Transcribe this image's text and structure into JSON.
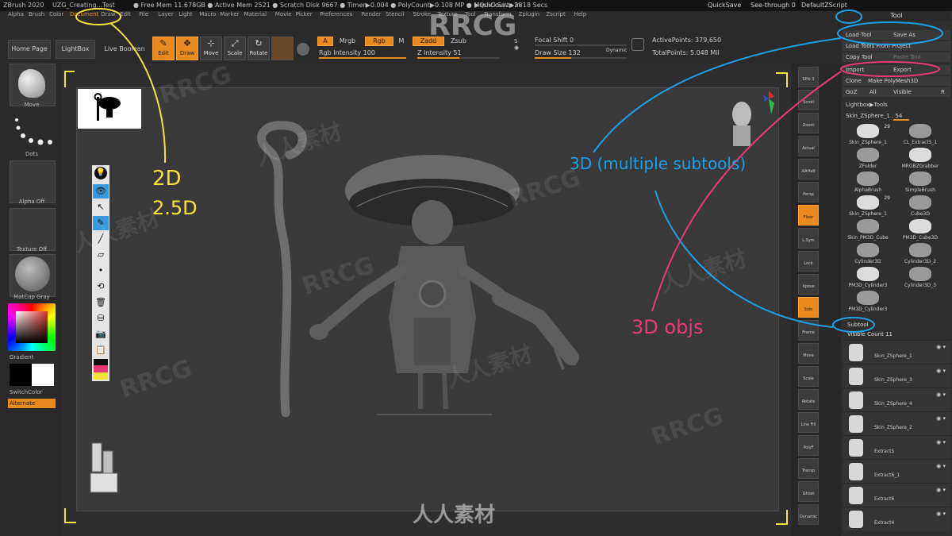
{
  "menubar": {
    "app_title": "ZBrush 2020",
    "file": "UZG_Creating...Test",
    "stats": "● Free Mem 11.678GB ● Active Mem 2521 ● Scratch Disk 9667 ● Timer▶0.004 ● PolyCount▶0.108 MP ● MeshCount▶28",
    "quicksave_timer": "▶QuickSave In 18 Secs",
    "menus": [
      "Alpha",
      "Brush",
      "Color",
      "Document",
      "Draw",
      "Edit",
      "File",
      "Layer",
      "Light",
      "Macro",
      "Marker",
      "Material",
      "Movie",
      "Picker",
      "Preferences",
      "Render",
      "Stencil",
      "Stroke",
      "Texture",
      "Tool",
      "Transform",
      "Zplugin",
      "Zscript",
      "Help"
    ],
    "quicksave": "QuickSave",
    "seethrough": "See-through 0",
    "default_script": "DefaultZScript"
  },
  "toolbar": {
    "home_page": "Home Page",
    "lightbox": "LightBox",
    "live_boolean": "Live Boolean",
    "edit": "Edit",
    "draw": "Draw",
    "move": "Move",
    "scale": "Scale",
    "rotate": "Rotate",
    "a_label": "A",
    "mrgb": "Mrgb",
    "rgb": "Rgb",
    "m": "M",
    "zadd": "Zadd",
    "zsub": "Zsub",
    "rgb_intensity": "Rgb Intensity 100",
    "z_intensity": "Z Intensity 51",
    "rgb_intensity_value": 100,
    "z_intensity_value": 51,
    "focal_shift": "Focal Shift 0",
    "draw_size": "Draw Size 132",
    "dynamic": "Dynamic",
    "active_points": "ActivePoints: 379,650",
    "total_points": "TotalPoints: 5.048 Mil"
  },
  "left_shelf": {
    "brush_label": "Move",
    "stroke_label": "Dots",
    "alpha_label": "Alpha Off",
    "texture_label": "Texture Off",
    "material_label": "MatCap Gray",
    "gradient_label": "Gradient",
    "switchcolor_label": "SwitchColor",
    "alternate_label": "Alternate"
  },
  "right_shelf": {
    "buttons": [
      "SPix 3",
      "Scroll",
      "Zoom",
      "Actual",
      "AAHalf",
      "Persp",
      "Floor",
      "L.Sym",
      "Lock",
      "Xpose",
      "Solo",
      "Frame",
      "Move",
      "Scale",
      "Rotate",
      "Line Fill",
      "PolyF",
      "Transp",
      "Ghost",
      "Dynamic"
    ]
  },
  "tool_palette": {
    "title": "Tool",
    "load_tool": "Load Tool",
    "save_as": "Save As",
    "load_tools_project": "Load Tools From Project",
    "copy_tool": "Copy Tool",
    "paste_tool": "Paste Tool",
    "import": "Import",
    "export": "Export",
    "clone": "Clone",
    "make_polymesh": "Make PolyMesh3D",
    "goz": "GoZ",
    "all": "All",
    "visible": "Visible",
    "r": "R",
    "lightbox_tools": "Lightbox▶Tools",
    "current_tool": "Skin_ZSphere_1 . 54",
    "tiles": [
      {
        "label": "Skin_ZSphere_1",
        "count": "29"
      },
      {
        "label": "CL_Extract5_1",
        "count": ""
      },
      {
        "label": "ZFolder",
        "count": ""
      },
      {
        "label": "MRGBZGrabber",
        "count": ""
      },
      {
        "label": "AlphaBrush",
        "count": ""
      },
      {
        "label": "SimpleBrush",
        "count": ""
      },
      {
        "label": "Skin_ZSphere_1",
        "count": "29"
      },
      {
        "label": "Cube3D",
        "count": ""
      },
      {
        "label": "Skin_PM3D_Cube",
        "count": ""
      },
      {
        "label": "PM3D_Cube3D",
        "count": ""
      },
      {
        "label": "Cylinder3D",
        "count": ""
      },
      {
        "label": "Cylinder3D_2",
        "count": ""
      },
      {
        "label": "PM3D_Cylinder3",
        "count": ""
      },
      {
        "label": "Cylinder3D_3",
        "count": ""
      },
      {
        "label": "PM3D_Cylinder3",
        "count": ""
      }
    ],
    "subtool": "Subtool",
    "visible_count": "Visible Count 11",
    "subtools": [
      {
        "label": "Skin_ZSphere_1"
      },
      {
        "label": "Skin_ZSphere_3"
      },
      {
        "label": "Skin_ZSphere_4"
      },
      {
        "label": "Skin_ZSphere_2"
      },
      {
        "label": "Extract5"
      },
      {
        "label": "Extract6_1"
      },
      {
        "label": "Extract6"
      },
      {
        "label": "Extract4"
      }
    ]
  },
  "annotations": {
    "two_d": "2D",
    "two_five_d": "2.5D",
    "three_d_multiple": "3D (multiple subtools)",
    "three_d_objs": "3D objs"
  },
  "watermarks": {
    "rrcg": "RRCG",
    "cn": "人人素材"
  },
  "colors": {
    "accent": "#e88a1e",
    "annot_yellow": "#f2e23a",
    "annot_blue": "#1ea0e6",
    "annot_pink": "#e83a7a"
  }
}
